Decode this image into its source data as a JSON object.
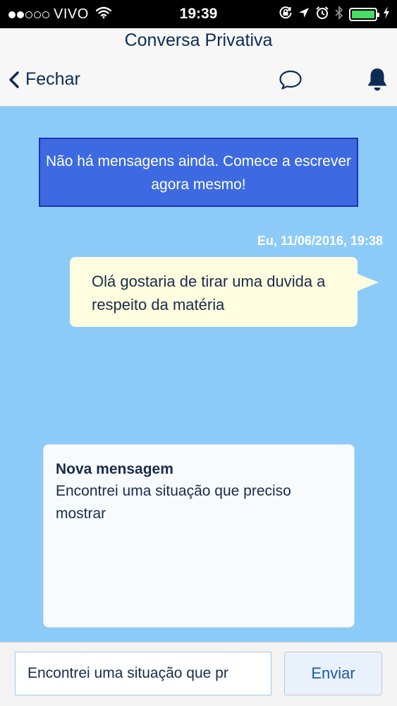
{
  "status_bar": {
    "carrier": "VIVO",
    "time": "19:39",
    "signal_bars_filled": 2,
    "signal_bars_total": 5,
    "battery_level": 1.0,
    "icons": [
      "wifi-icon",
      "rotation-lock-icon",
      "location-icon",
      "alarm-icon",
      "bluetooth-icon",
      "battery-icon",
      "charging-icon"
    ]
  },
  "header": {
    "title": "Conversa Privativa",
    "back_label": "Fechar",
    "icons": [
      "chevron-left-icon",
      "chat-bubble-icon",
      "bell-icon"
    ]
  },
  "chat": {
    "empty_notice": "Não há mensagens ainda. Comece a escrever agora mesmo!",
    "message": {
      "meta": "Eu, 11/06/2016, 19:38",
      "text": "Olá gostaria de tirar uma duvida a respeito da matéria"
    },
    "preview": {
      "title": "Nova mensagem",
      "text": "Encontrei uma situação que preciso mostrar"
    }
  },
  "compose": {
    "value": "Encontrei uma situação que pr",
    "send_label": "Enviar"
  },
  "colors": {
    "chat_background": "#8ccbf8",
    "notice_background": "#3d6ae0",
    "bubble_background": "#fffde0",
    "header_text": "#0b2c55",
    "battery": "#4cd964"
  }
}
